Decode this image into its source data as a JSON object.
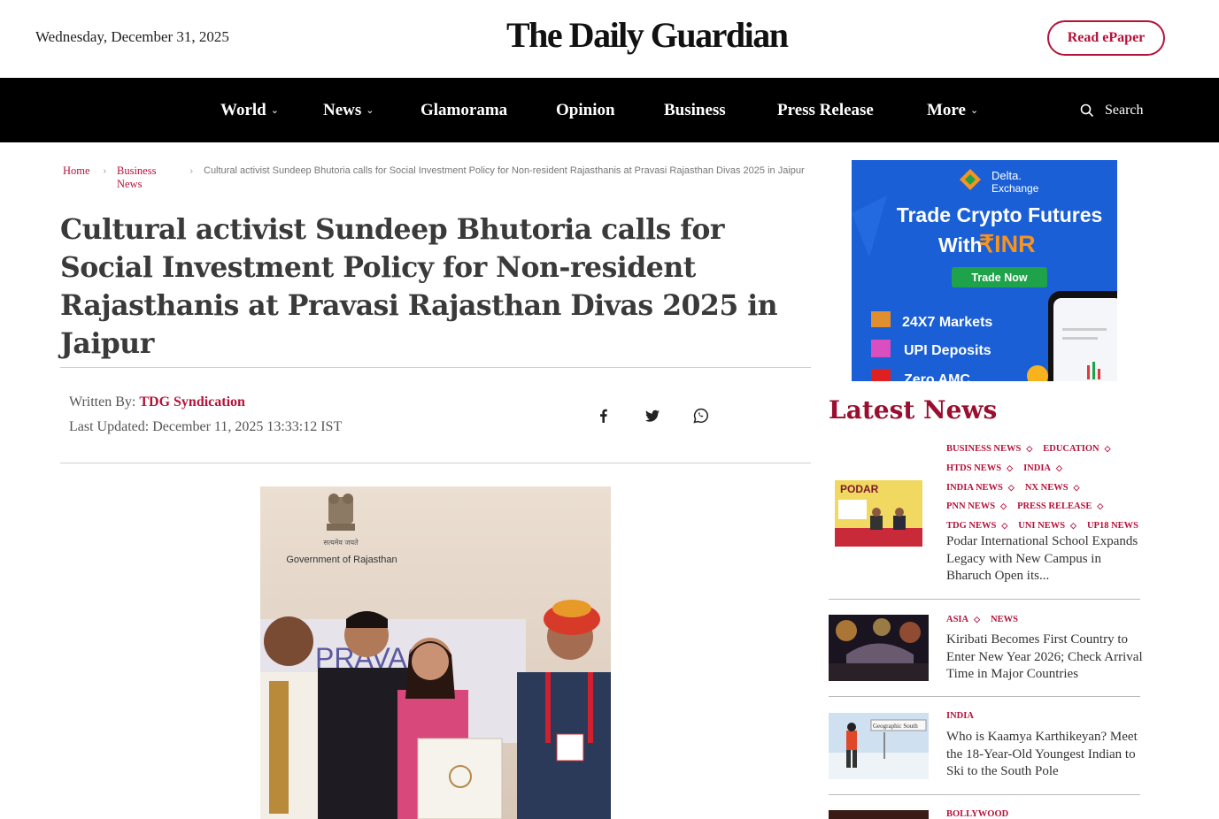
{
  "header": {
    "date": "Wednesday, December 31, 2025",
    "logo": "The Daily Guardian",
    "epaper_label": "Read ePaper"
  },
  "nav": {
    "items": [
      {
        "label": "World",
        "dropdown": true
      },
      {
        "label": "News",
        "dropdown": true
      },
      {
        "label": "Glamorama",
        "dropdown": false
      },
      {
        "label": "Opinion",
        "dropdown": false
      },
      {
        "label": "Business",
        "dropdown": false
      },
      {
        "label": "Press Release",
        "dropdown": false
      },
      {
        "label": "More",
        "dropdown": true
      }
    ],
    "search_label": "Search"
  },
  "breadcrumb": {
    "home": "Home",
    "section_line1": "Business",
    "section_line2": "News",
    "current": "Cultural activist Sundeep Bhutoria calls for Social Investment Policy for Non-resident Rajasthanis at Pravasi Rajasthan Divas 2025 in Jaipur"
  },
  "article": {
    "headline": "Cultural activist Sundeep Bhutoria calls for Social Investment Policy for Non-resident Rajasthanis at Pravasi Rajasthan Divas 2025 in Jaipur",
    "written_by_label": "Written By: ",
    "author": "TDG Syndication",
    "last_updated": "Last Updated: December 11, 2025 13:33:12 IST",
    "photo_caption_text": "Government of Rajasthan",
    "photo_emblem_text": "सत्यमेव जयते"
  },
  "ad": {
    "brand": "Delta.",
    "brand_sub": "Exchange",
    "headline_line1": "Trade Crypto Futures",
    "headline_line2_prefix": "With ",
    "headline_line2_accent": "₹INR",
    "cta": "Trade Now",
    "features": [
      "24X7 Markets",
      "UPI Deposits",
      "Zero AMC"
    ]
  },
  "sidebar": {
    "title": "Latest News",
    "items": [
      {
        "tags": [
          [
            "BUSINESS NEWS",
            "EDUCATION"
          ],
          [
            "HTDS NEWS",
            "INDIA"
          ],
          [
            "INDIA NEWS",
            "NX NEWS"
          ],
          [
            "PNN NEWS",
            "PRESS RELEASE"
          ],
          [
            "TDG NEWS",
            "UNI NEWS",
            "UP18 NEWS"
          ]
        ],
        "title": "Podar International School Expands Legacy with New Campus in Bharuch Open its..."
      },
      {
        "tags": [
          [
            "ASIA",
            "NEWS"
          ]
        ],
        "title": "Kiribati Becomes First Country to Enter New Year 2026; Check Arrival Time in Major Countries"
      },
      {
        "tags": [
          [
            "INDIA"
          ]
        ],
        "title": "Who is Kaamya Karthikeyan? Meet the 18-Year-Old Youngest Indian to Ski to the South Pole"
      },
      {
        "tags": [
          [
            "BOLLYWOOD"
          ]
        ],
        "title": ""
      }
    ]
  },
  "colors": {
    "brand_red": "#b5123a",
    "nav_bg": "#000000",
    "ad_blue": "#1a5fd6",
    "ad_green": "#1ea34a"
  }
}
